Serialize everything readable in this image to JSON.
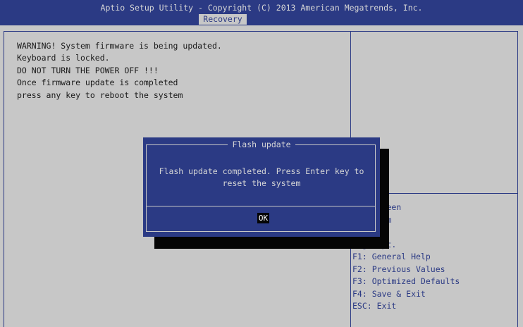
{
  "header": {
    "title": "Aptio Setup Utility - Copyright (C) 2013 American Megatrends, Inc.",
    "active_tab": "Recovery"
  },
  "main": {
    "warning_lines": [
      "WARNING! System firmware is being updated.",
      "Keyboard is locked.",
      "DO NOT TURN THE POWER OFF !!!",
      "Once firmware update is completed",
      "press any key to reboot the system"
    ]
  },
  "help_panel": {
    "lines": [
      "ect Screen",
      "ect Item",
      "Select",
      "ange Opt.",
      "F1: General Help",
      "F2: Previous Values",
      "F3: Optimized Defaults",
      "F4: Save & Exit",
      "ESC: Exit"
    ]
  },
  "dialog": {
    "title": "Flash update",
    "message": "Flash update completed. Press Enter key to reset the system",
    "ok_label": "OK"
  },
  "colors": {
    "bios_blue": "#2b3a84",
    "bios_gray": "#c7c7c7",
    "shadow": "#050505"
  }
}
